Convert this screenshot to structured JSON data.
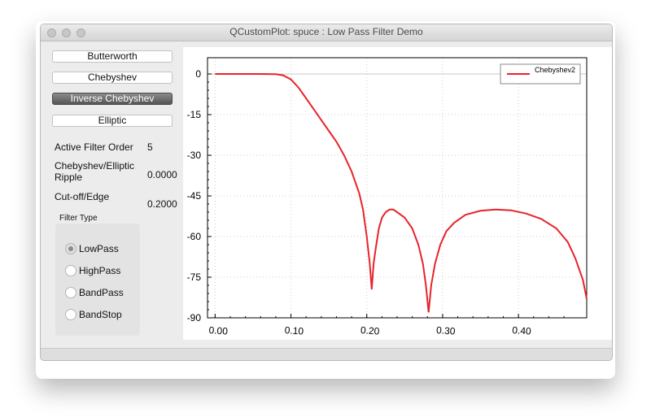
{
  "window": {
    "title": "QCustomPlot: spuce : Low Pass Filter Demo"
  },
  "buttons": {
    "butterworth": "Butterworth",
    "chebyshev": "Chebyshev",
    "inverse_chebyshev": "Inverse Chebyshev",
    "elliptic": "Elliptic"
  },
  "params": {
    "order_label": "Active Filter Order",
    "order_value": "5",
    "ripple_label_line1": "Chebyshev/Elliptic",
    "ripple_label_line2": "Ripple",
    "ripple_value": "0.0000",
    "cutoff_label": "Cut-off/Edge",
    "cutoff_value": "0.2000"
  },
  "filter_type": {
    "title": "Filter Type",
    "options": [
      "LowPass",
      "HighPass",
      "BandPass",
      "BandStop"
    ],
    "selected": "LowPass"
  },
  "colors": {
    "accent": "#e8232b",
    "active_button": "#6e6e6e"
  },
  "chart_data": {
    "type": "line",
    "title": "",
    "xlabel": "",
    "ylabel": "",
    "xlim": [
      -0.01,
      0.49
    ],
    "ylim": [
      -90,
      6
    ],
    "x_ticks": [
      0.0,
      0.1,
      0.2,
      0.3,
      0.4
    ],
    "x_tick_labels": [
      "0.00",
      "0.10",
      "0.20",
      "0.30",
      "0.40"
    ],
    "y_ticks": [
      0,
      -15,
      -30,
      -45,
      -60,
      -75,
      -90
    ],
    "y_tick_labels": [
      "0",
      "-15",
      "-30",
      "-45",
      "-60",
      "-75",
      "-90"
    ],
    "grid": true,
    "legend": "top-right",
    "series": [
      {
        "name": "Chebyshev2",
        "color": "#e8232b",
        "points": [
          [
            0.0,
            0
          ],
          [
            0.02,
            0
          ],
          [
            0.04,
            0
          ],
          [
            0.06,
            0
          ],
          [
            0.08,
            -0.1
          ],
          [
            0.09,
            -0.5
          ],
          [
            0.1,
            -2
          ],
          [
            0.11,
            -5
          ],
          [
            0.12,
            -9
          ],
          [
            0.13,
            -13
          ],
          [
            0.14,
            -17
          ],
          [
            0.15,
            -21
          ],
          [
            0.16,
            -25
          ],
          [
            0.17,
            -30
          ],
          [
            0.18,
            -36
          ],
          [
            0.19,
            -44
          ],
          [
            0.195,
            -50
          ],
          [
            0.2,
            -60
          ],
          [
            0.204,
            -70
          ],
          [
            0.2065,
            -79.5
          ],
          [
            0.209,
            -70
          ],
          [
            0.212,
            -64
          ],
          [
            0.216,
            -57
          ],
          [
            0.22,
            -53
          ],
          [
            0.225,
            -51
          ],
          [
            0.23,
            -50
          ],
          [
            0.235,
            -50
          ],
          [
            0.24,
            -51
          ],
          [
            0.25,
            -53
          ],
          [
            0.26,
            -57
          ],
          [
            0.268,
            -63
          ],
          [
            0.274,
            -70
          ],
          [
            0.278,
            -78
          ],
          [
            0.2815,
            -88
          ],
          [
            0.285,
            -78
          ],
          [
            0.29,
            -70
          ],
          [
            0.297,
            -63
          ],
          [
            0.305,
            -58
          ],
          [
            0.315,
            -55
          ],
          [
            0.33,
            -52
          ],
          [
            0.35,
            -50.5
          ],
          [
            0.37,
            -50
          ],
          [
            0.39,
            -50.3
          ],
          [
            0.41,
            -51.5
          ],
          [
            0.43,
            -53.5
          ],
          [
            0.45,
            -57
          ],
          [
            0.465,
            -62
          ],
          [
            0.475,
            -68
          ],
          [
            0.485,
            -76
          ],
          [
            0.49,
            -83
          ]
        ]
      }
    ]
  }
}
